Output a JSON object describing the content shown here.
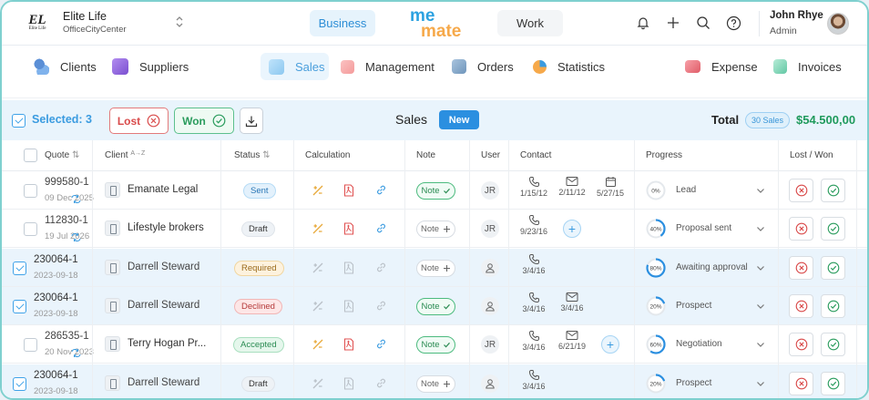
{
  "company": {
    "name": "Elite Life",
    "subtitle": "OfficeCityCenter",
    "logo_mark": "EL",
    "logo_sub": "Elite Life"
  },
  "workspaces": {
    "business": "Business",
    "work": "Work"
  },
  "brand": {
    "line1": "me",
    "line2": "mate"
  },
  "user": {
    "name": "John Rhye",
    "role": "Admin"
  },
  "nav": [
    {
      "label": "Clients",
      "icon": "clients-icon"
    },
    {
      "label": "Suppliers",
      "icon": "suppliers-icon"
    },
    {
      "label": "Sales",
      "icon": "sales-icon",
      "active": true
    },
    {
      "label": "Management",
      "icon": "management-icon"
    },
    {
      "label": "Orders",
      "icon": "orders-icon"
    },
    {
      "label": "Statistics",
      "icon": "statistics-icon"
    },
    {
      "label": "Expense",
      "icon": "expense-icon"
    },
    {
      "label": "Invoices",
      "icon": "invoices-icon"
    }
  ],
  "actionbar": {
    "selected": "Selected: 3",
    "lost": "Lost",
    "won": "Won",
    "title": "Sales",
    "new": "New",
    "total_label": "Total",
    "total_count": "30 Sales",
    "total_value": "$54.500,00"
  },
  "columns": {
    "quote": "Quote",
    "client": "Client",
    "client_sort": "A→Z",
    "status": "Status",
    "calculation": "Calculation",
    "note": "Note",
    "user": "User",
    "contact": "Contact",
    "progress": "Progress",
    "lost_won": "Lost / Won"
  },
  "rows": [
    {
      "selected": false,
      "quote": "999580-1",
      "date": "09 Dec 2025",
      "client": "Emanate Legal",
      "status": "Sent",
      "status_kind": "sent",
      "calc_active": true,
      "note": "Note",
      "note_on": true,
      "user": "JR",
      "contacts": [
        {
          "type": "phone",
          "date": "1/15/12"
        },
        {
          "type": "mail",
          "date": "2/11/12"
        },
        {
          "type": "calendar",
          "date": "5/27/15"
        }
      ],
      "add_contact": false,
      "progress": 0,
      "progress_label": "0%",
      "stage": "Lead"
    },
    {
      "selected": false,
      "quote": "112830-1",
      "date": "19 Jul 2026",
      "client": "Lifestyle brokers",
      "status": "Draft",
      "status_kind": "draft",
      "calc_active": true,
      "note": "Note",
      "note_on": false,
      "user": "JR",
      "contacts": [
        {
          "type": "phone",
          "date": "9/23/16"
        }
      ],
      "add_contact": true,
      "progress": 40,
      "progress_label": "40%",
      "stage": "Proposal sent"
    },
    {
      "selected": true,
      "quote": "230064-1",
      "date": "2023-09-18",
      "client": "Darrell Steward",
      "status": "Required",
      "status_kind": "required",
      "calc_active": false,
      "note": "Note",
      "note_on": false,
      "user": "",
      "contacts": [
        {
          "type": "phone",
          "date": "3/4/16"
        }
      ],
      "add_contact": false,
      "progress": 80,
      "progress_label": "80%",
      "stage": "Awaiting approval"
    },
    {
      "selected": true,
      "quote": "230064-1",
      "date": "2023-09-18",
      "client": "Darrell Steward",
      "status": "Declined",
      "status_kind": "declined",
      "calc_active": false,
      "note": "Note",
      "note_on": true,
      "user": "",
      "contacts": [
        {
          "type": "phone",
          "date": "3/4/16"
        },
        {
          "type": "mail",
          "date": "3/4/16"
        }
      ],
      "add_contact": false,
      "progress": 20,
      "progress_label": "20%",
      "stage": "Prospect"
    },
    {
      "selected": false,
      "quote": "286535-1",
      "date": "20 Nov 2023",
      "client": "Terry Hogan Pr...",
      "status": "Accepted",
      "status_kind": "accepted",
      "calc_active": true,
      "note": "Note",
      "note_on": true,
      "user": "JR",
      "contacts": [
        {
          "type": "phone",
          "date": "3/4/16"
        },
        {
          "type": "mail",
          "date": "6/21/19"
        }
      ],
      "add_contact": true,
      "progress": 60,
      "progress_label": "60%",
      "stage": "Negotiation"
    },
    {
      "selected": true,
      "quote": "230064-1",
      "date": "2023-09-18",
      "client": "Darrell Steward",
      "status": "Draft",
      "status_kind": "draft",
      "calc_active": false,
      "note": "Note",
      "note_on": false,
      "user": "",
      "contacts": [
        {
          "type": "phone",
          "date": "3/4/16"
        }
      ],
      "add_contact": false,
      "progress": 20,
      "progress_label": "20%",
      "stage": "Prospect"
    }
  ],
  "colors": {
    "accent": "#2b8fe0",
    "won": "#2a9c5d",
    "lost": "#d94a4a",
    "ring": "#2b8fe0"
  }
}
